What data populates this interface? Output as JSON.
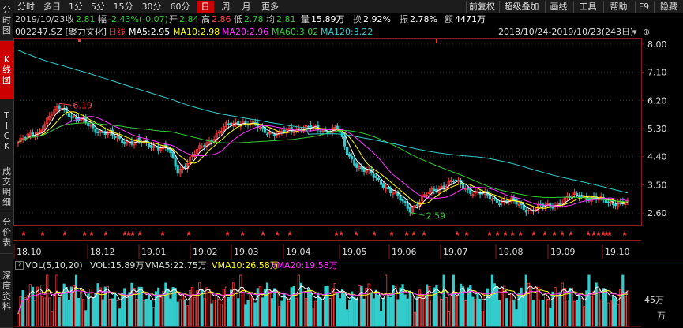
{
  "sidebar": {
    "tabs": [
      {
        "label": "分时图",
        "active": false
      },
      {
        "label": "K线图",
        "active": true
      },
      {
        "label": "TICK",
        "active": false
      },
      {
        "label": "成交明细",
        "active": false
      },
      {
        "label": "分价表",
        "active": false
      },
      {
        "label": "深度资料",
        "active": false
      }
    ]
  },
  "toolbar": {
    "periods": [
      {
        "label": "分时",
        "active": false
      },
      {
        "label": "多日",
        "active": false
      },
      {
        "label": "1分",
        "active": false
      },
      {
        "label": "5分",
        "active": false
      },
      {
        "label": "15分",
        "active": false
      },
      {
        "label": "30分",
        "active": false
      },
      {
        "label": "60分",
        "active": false
      },
      {
        "label": "日",
        "active": true
      },
      {
        "label": "周",
        "active": false
      },
      {
        "label": "月",
        "active": false
      },
      {
        "label": "更多",
        "active": false
      }
    ],
    "tools": [
      "前复权",
      "超级叠加",
      "画线",
      "工具",
      "帮助",
      "F9",
      "隐藏"
    ],
    "dropdown_glyph": "▾"
  },
  "quote": {
    "date": "2019/10/23",
    "close_label": "收",
    "close": "2.81",
    "change_label": "幅",
    "change": "-2.43%(-0.07)",
    "open_label": "开",
    "open": "2.84",
    "high_label": "高",
    "high": "2.86",
    "low_label": "低",
    "low": "2.78",
    "avg_label": "均",
    "avg": "2.81",
    "volume_label": "量",
    "volume": "15.89万",
    "turnover_label": "换",
    "turnover": "2.92%",
    "amplitude_label": "振",
    "amplitude": "2.78%",
    "amount_label": "额",
    "amount": "4471万"
  },
  "ma_line": {
    "code_name": "002247.SZ [聚力文化]",
    "line_type": "日线",
    "ma5": "MA5:2.95",
    "ma10": "MA10:2.98",
    "ma20": "MA20:2.96",
    "ma60": "MA60:3.02",
    "ma120": "MA120:3.22",
    "date_range": "2018/10/24-2019/10/23(243日)",
    "colors": {
      "ma5": "#ffffff",
      "ma10": "#ffff00",
      "ma20": "#ff33ff",
      "ma60": "#33cc33",
      "ma120": "#33cccc"
    }
  },
  "volume_header": {
    "expand_glyph": "?",
    "indicator": "VOL(5,10,20)",
    "vol": "VOL:15.89万",
    "vma5": "VMA5:22.75万",
    "vma10": "VMA10:26.58万",
    "vma20": "VMA20:19.58万"
  },
  "chart_data": {
    "type": "candlestick",
    "price_axis_ticks": [
      "8.00",
      "7.10",
      "6.20",
      "5.30",
      "4.40",
      "3.50",
      "2.60"
    ],
    "ylim": [
      2.2,
      8.2
    ],
    "date_axis_ticks": [
      "18.10",
      "18.12",
      "19.01",
      "19.02",
      "19.03",
      "19.04",
      "19.05",
      "19.06",
      "19.07",
      "19.08",
      "19.09",
      "19.10"
    ],
    "annotations": [
      {
        "label": "6.19",
        "kind": "high"
      },
      {
        "label": "2.59",
        "kind": "low"
      }
    ],
    "volume_axis_tick": "45万",
    "volume_unit_label": "万",
    "marker_glyph": "★",
    "colors": {
      "up": "#ff3b3b",
      "down": "#33cccc",
      "grid": "#7a1010",
      "axis": "#8b1a1a"
    }
  }
}
